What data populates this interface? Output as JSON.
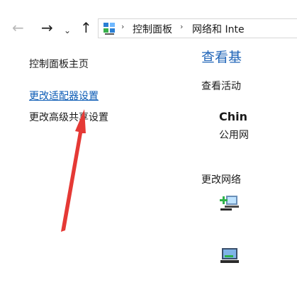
{
  "toolbar": {
    "back_icon": "←",
    "forward_icon": "→",
    "dropdown_icon": "⌄",
    "up_icon": "↑"
  },
  "address": {
    "crumbs": [
      "控制面板",
      "网络和 Inte"
    ],
    "separator": "›"
  },
  "sidebar": {
    "home": "控制面板主页",
    "change_adapter": "更改适配器设置",
    "advanced_sharing": "更改高级共享设置"
  },
  "main": {
    "title": "查看基",
    "active_networks": "查看活动",
    "network_name": "Chin",
    "network_type": "公用网",
    "change_settings": "更改网络"
  },
  "colors": {
    "link": "#0b5bb5",
    "title": "#2065b8",
    "annotation_arrow": "#e53935"
  },
  "icons": {
    "address": "network-control-panel-icon",
    "new_connection": "new-connection-icon",
    "troubleshoot": "troubleshoot-icon"
  }
}
